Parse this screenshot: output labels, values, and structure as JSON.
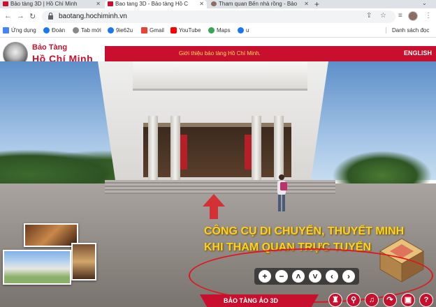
{
  "browser": {
    "tabs": [
      {
        "label": "Bảo tàng 3D | Hồ Chí Minh",
        "active": false
      },
      {
        "label": "Bao tang 3D - Bảo tàng Hồ C",
        "active": true
      },
      {
        "label": "Tham quan Bến nhà rồng - Bảo",
        "active": false
      }
    ],
    "new_tab": "+",
    "url": "baotang.hochiminh.vn",
    "bookmarks": [
      {
        "label": "Ứng dụng",
        "color": "#4285f4"
      },
      {
        "label": "Đoàn",
        "color": "#1877f2"
      },
      {
        "label": "Tab mới",
        "color": "#888888"
      },
      {
        "label": "9ie62u",
        "color": "#1877f2"
      },
      {
        "label": "Gmail",
        "color": "#ea4335"
      },
      {
        "label": "YouTube",
        "color": "#ff0000"
      },
      {
        "label": "Maps",
        "color": "#34a853"
      },
      {
        "label": "u",
        "color": "#1877f2"
      }
    ],
    "reading_list": "Danh sách đọc"
  },
  "site": {
    "logo_line1": "Bảo Tàng",
    "logo_line2": "Hồ Chí Minh",
    "intro": "Giới thiệu bảo tàng Hồ Chí Minh.",
    "english": "ENGLISH",
    "brand_red": "#c8102e"
  },
  "overlay": {
    "promo_line1": "CÔNG CỤ DI CHUYỂN, THUYẾT MINH",
    "promo_line2": "KHI THAM QUAN TRỰC TUYẾN",
    "promo_color": "#ffd21a"
  },
  "controls": {
    "buttons": [
      {
        "name": "zoom-in",
        "glyph": "+"
      },
      {
        "name": "zoom-out",
        "glyph": "−"
      },
      {
        "name": "move-up",
        "glyph": "⌃"
      },
      {
        "name": "move-down",
        "glyph": "⌄"
      },
      {
        "name": "move-left",
        "glyph": "‹"
      },
      {
        "name": "move-right",
        "glyph": "›"
      }
    ]
  },
  "bottom": {
    "label": "BẢO TÀNG ẢO 3D",
    "icons": [
      {
        "name": "narration",
        "glyph": "♜"
      },
      {
        "name": "link",
        "glyph": "⚲"
      },
      {
        "name": "music",
        "glyph": "♫"
      },
      {
        "name": "share",
        "glyph": "↷"
      },
      {
        "name": "fullscreen",
        "glyph": "▣"
      },
      {
        "name": "help",
        "glyph": "?"
      }
    ]
  }
}
